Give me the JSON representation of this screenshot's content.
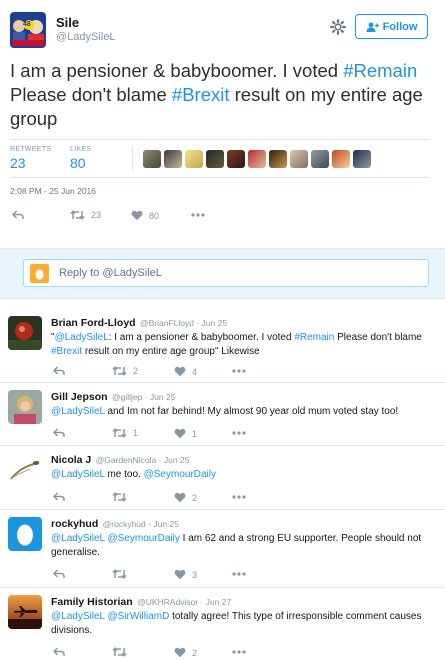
{
  "tweet": {
    "name": "Sile",
    "handle": "@LadySileL",
    "avatar_badge": "48",
    "follow_label": "Follow",
    "text_parts": [
      "I am a pensioner & babyboomer. I voted ",
      "#Remain",
      " Please don't blame ",
      "#Brexit",
      " result on my entire age group"
    ],
    "retweets_label": "RETWEETS",
    "retweets": "23",
    "likes_label": "LIKES",
    "likes": "80",
    "timestamp": "2:08 PM - 25 Jun 2016",
    "action_retweets": "23",
    "action_likes": "80"
  },
  "reply_box": {
    "placeholder": "Reply to @LadySileL"
  },
  "replies": [
    {
      "name": "Brian Ford-Lloyd",
      "handle": "@BrianFLloyd",
      "date": "Jun 25",
      "text_parts": [
        "\"",
        "@LadySileL",
        ": I am a pensioner & babyboomer. I voted ",
        "#Remain",
        " Please don't blame ",
        "#Brexit",
        " result on my entire age group\" Likewise"
      ],
      "retweets": "2",
      "likes": "4"
    },
    {
      "name": "Gill Jepson",
      "handle": "@gilljep",
      "date": "Jun 25",
      "text_parts": [
        "@LadySileL",
        " and Im not far behind! My almost 90 year old mum voted stay too!"
      ],
      "retweets": "1",
      "likes": "1"
    },
    {
      "name": "Nicola J",
      "handle": "@GardenNicola",
      "date": "Jun 25",
      "text_parts": [
        "@LadySileL",
        " me too. ",
        "@SeymourDaily"
      ],
      "retweets": "",
      "likes": "2"
    },
    {
      "name": "rockyhud",
      "handle": "@rockyhud",
      "date": "Jun 25",
      "text_parts": [
        "@LadySileL",
        " ",
        "@SeymourDaily",
        " I am 62 and a strong  EU supporter. People should not generalise."
      ],
      "retweets": "",
      "likes": "3"
    },
    {
      "name": "Family Historian",
      "handle": "@UKHRAdvisor",
      "date": "Jun 27",
      "text_parts": [
        "@LadySileL",
        " ",
        "@SirWilliamD",
        " totally agree! This type of irresponsible comment causes divisions."
      ],
      "retweets": "",
      "likes": "2"
    }
  ],
  "separator": "·",
  "colors": {
    "link": "#1b95e0",
    "muted": "#8899a6",
    "reply_bar_bg": "#e8f5fd",
    "egg": "#ffac33"
  },
  "icons": [
    "gear-icon",
    "follow-person-icon",
    "reply-icon",
    "retweet-icon",
    "heart-icon",
    "more-icon",
    "egg-avatar-icon"
  ]
}
